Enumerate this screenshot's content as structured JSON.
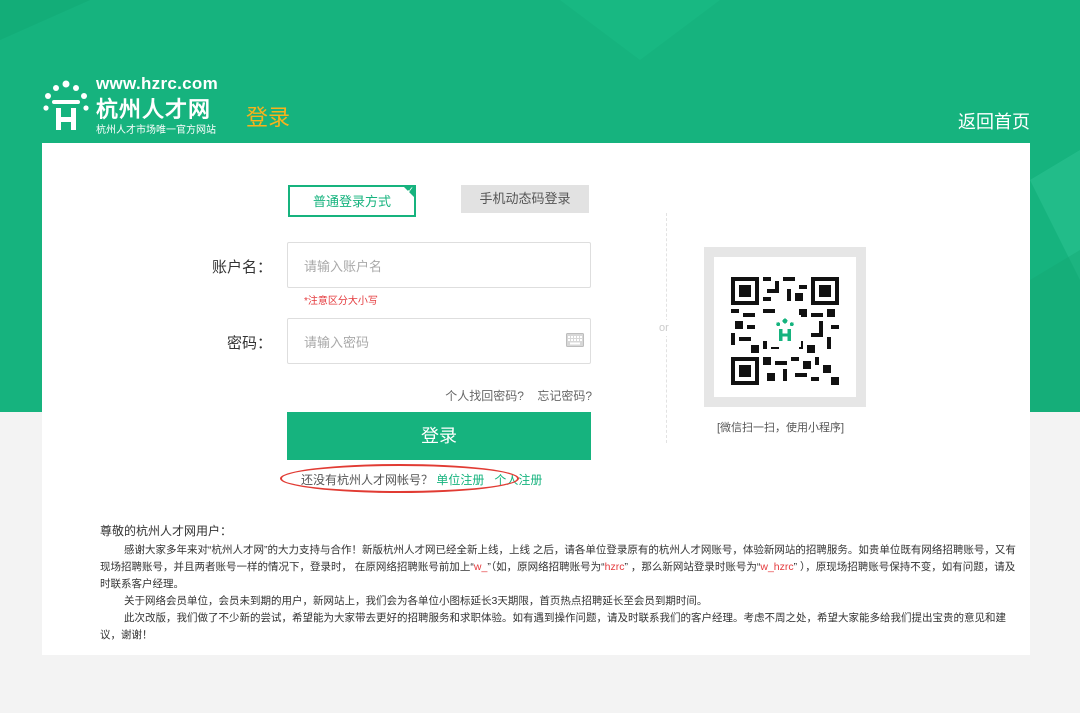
{
  "header": {
    "logo_url": "www.hzrc.com",
    "logo_name": "杭州人才网",
    "logo_tagline": "杭州人才市场唯一官方网站",
    "page_title": "登录",
    "back_home": "返回首页"
  },
  "tabs": {
    "normal": "普通登录方式",
    "sms": "手机动态码登录"
  },
  "form": {
    "account_label": "账户名：",
    "account_placeholder": "请输入账户名",
    "case_hint": "*注意区分大小写",
    "password_label": "密码：",
    "password_placeholder": "请输入密码",
    "personal_recover": "个人找回密码?",
    "forgot_password": "忘记密码?",
    "login_button": "登录",
    "no_account": "还没有杭州人才网帐号？",
    "company_register": "单位注册",
    "personal_register": "个人注册"
  },
  "qr": {
    "or": "or",
    "caption": "[微信扫一扫，使用小程序]"
  },
  "notice": {
    "greeting": "尊敬的杭州人才网用户：",
    "p1_a": "感谢大家多年来对“杭州人才网”的大力支持与合作！新版杭州人才网已经全新上线，上线 之后，请各单位登录原有的杭州人才网账号，体验新网站的招聘服务。如贵单位既有网络招聘账号，又有现场招聘账号，并且两者账号一样的情况下，登录时， 在原网络招聘账号前加上“",
    "p1_red1": "w_",
    "p1_b": "”（如，原网络招聘账号为“",
    "p1_red2": "hzrc",
    "p1_c": "” ，那么新网站登录时账号为“",
    "p1_red3": "w_hzrc",
    "p1_d": "” ），原现场招聘账号保持不变，如有问题，请及时联系客户经理。",
    "p2": "关于网络会员单位，会员未到期的用户，新网站上，我们会为各单位小图标延长3天期限，首页热点招聘延长至会员到期时间。",
    "p3": "此次改版，我们做了不少新的尝试，希望能为大家带去更好的招聘服务和求职体验。如有遇到操作问题，请及时联系我们的客户经理。考虑不周之处，希望大家能多给我们提出宝贵的意见和建议，谢谢！"
  },
  "colors": {
    "brand_green": "#16b37e",
    "accent_yellow": "#f9b21b",
    "alert_red": "#e4393c"
  }
}
